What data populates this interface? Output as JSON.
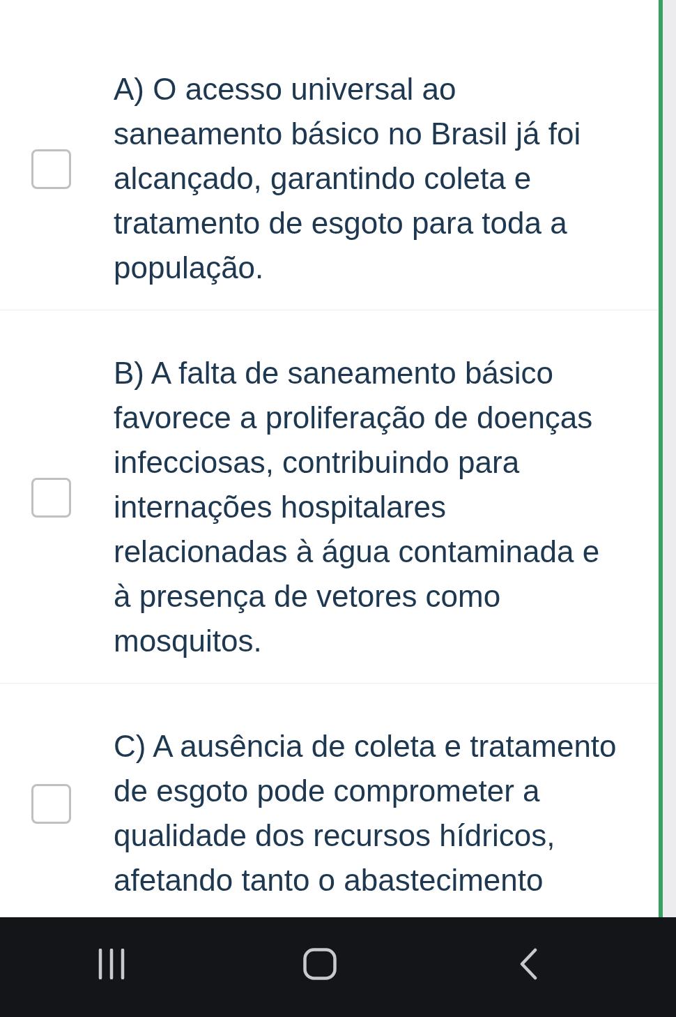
{
  "options": [
    {
      "text": "A) O acesso universal ao saneamento básico no Brasil já foi alcançado, garantindo coleta e tratamento de esgoto para toda a população.",
      "checked": false
    },
    {
      "text": "B) A falta de saneamento básico favorece a proliferação de doenças infecciosas, contribuindo para internações hospitalares relacionadas à água contaminada e à presença de vetores como mosquitos.",
      "checked": false
    },
    {
      "text": "C) A ausência de coleta e tratamento de esgoto pode comprometer a qualidade dos recursos hídricos, afetando tanto o abastecimento",
      "checked": false
    }
  ],
  "navigation_bar": {
    "buttons": [
      {
        "kind": "recents"
      },
      {
        "kind": "home"
      },
      {
        "kind": "back"
      }
    ]
  }
}
